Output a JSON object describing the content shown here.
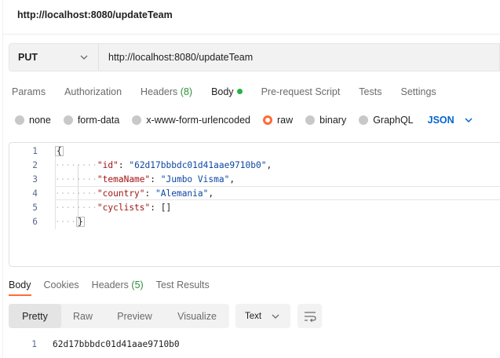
{
  "request": {
    "title": "http://localhost:8080/updateTeam",
    "method": "PUT",
    "url": "http://localhost:8080/updateTeam"
  },
  "request_tabs": {
    "params": "Params",
    "authorization": "Authorization",
    "headers": "Headers",
    "headers_count": "(8)",
    "body": "Body",
    "prerequest": "Pre-request Script",
    "tests": "Tests",
    "settings": "Settings"
  },
  "body_options": {
    "none": "none",
    "form_data": "form-data",
    "urlencoded": "x-www-form-urlencoded",
    "raw": "raw",
    "binary": "binary",
    "graphql": "GraphQL",
    "format": "JSON",
    "selected": "raw"
  },
  "editor": {
    "line_numbers": [
      "1",
      "2",
      "3",
      "4",
      "5",
      "6"
    ],
    "open_brace": "{",
    "close_brace": "}",
    "fields": [
      {
        "key": "\"id\"",
        "value": "\"62d17bbbdc01d41aae9710b0\"",
        "suffix": ","
      },
      {
        "key": "\"temaName\"",
        "value": "\"Jumbo Visma\"",
        "suffix": ","
      },
      {
        "key": "\"country\"",
        "value": "\"Alemania\"",
        "suffix": ","
      },
      {
        "key": "\"cyclists\"",
        "value": "[]",
        "suffix": ""
      }
    ]
  },
  "response_tabs": {
    "body": "Body",
    "cookies": "Cookies",
    "headers": "Headers",
    "headers_count": "(5)",
    "test_results": "Test Results"
  },
  "response_view": {
    "pretty": "Pretty",
    "raw": "Raw",
    "preview": "Preview",
    "visualize": "Visualize",
    "format": "Text"
  },
  "response": {
    "line_number": "1",
    "value": "62d17bbbdc01d41aae9710b0"
  },
  "colors": {
    "accent_orange": "#ff6c37",
    "link_blue": "#0265d2",
    "success_green": "#26b247",
    "json_key": "#a21515",
    "json_string": "#0d47a1"
  }
}
